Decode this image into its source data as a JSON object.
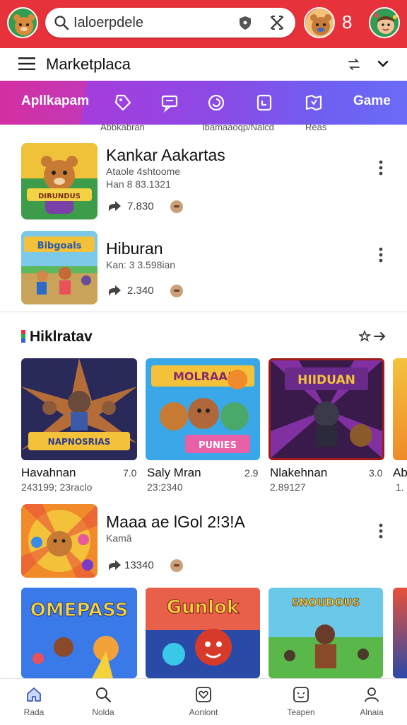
{
  "search": {
    "value": "Ialoerpdele"
  },
  "top": {
    "notification_count": "8"
  },
  "header": {
    "title": "Marketplaca"
  },
  "categories": {
    "first": "Apllkapam",
    "last": "Game",
    "icons": [
      "tag-icon",
      "chat-icon",
      "swirl-icon",
      "clipboard-icon",
      "map-icon"
    ],
    "sublabels": [
      "Abbkabran",
      "Ibamaaoqp/Nalcd",
      "Reas"
    ]
  },
  "apps": [
    {
      "title": "Kankar Aakartas",
      "line1": "Ataole 4shtoome",
      "line2": "Han 8 83.1321",
      "stat": "7.830"
    },
    {
      "title": "Hiburan",
      "line1": "Kan: 3 3.598ian",
      "stat": "2.340"
    }
  ],
  "section": {
    "title": "Hiklratav"
  },
  "cards": [
    {
      "title": "Havahnan",
      "rating": "7.0",
      "sub": "243199; 23raclo",
      "banner": "NAPNOSRIAS"
    },
    {
      "title": "Saly Mran",
      "rating": "2.9",
      "sub": "23:2340",
      "banner": "PUNIES"
    },
    {
      "title": "Nlakehnan",
      "rating": "3.0",
      "sub": "2.89127",
      "banner": "HIIDUAN"
    },
    {
      "title": "Ab",
      "sub": "1."
    }
  ],
  "featured": {
    "title": "Maaa ae lGol 2!3!A",
    "sub": "Kamâ",
    "stat": "13340"
  },
  "bottom_cards": [
    "OMEPASS",
    "Gunlok",
    "SNOUDOUS"
  ],
  "nav": [
    {
      "label": "Rada",
      "icon": "home-icon"
    },
    {
      "label": "Nolda",
      "icon": "search-icon"
    },
    {
      "label": "Aonlont",
      "icon": "heart-box-icon"
    },
    {
      "label": "Teapen",
      "icon": "smile-box-icon"
    },
    {
      "label": "Alnaia",
      "icon": "person-icon"
    }
  ],
  "colors": {
    "topbar": "#e8323b",
    "accent_purple": "#9a2fd0",
    "active_tab": "#d42fa0"
  }
}
